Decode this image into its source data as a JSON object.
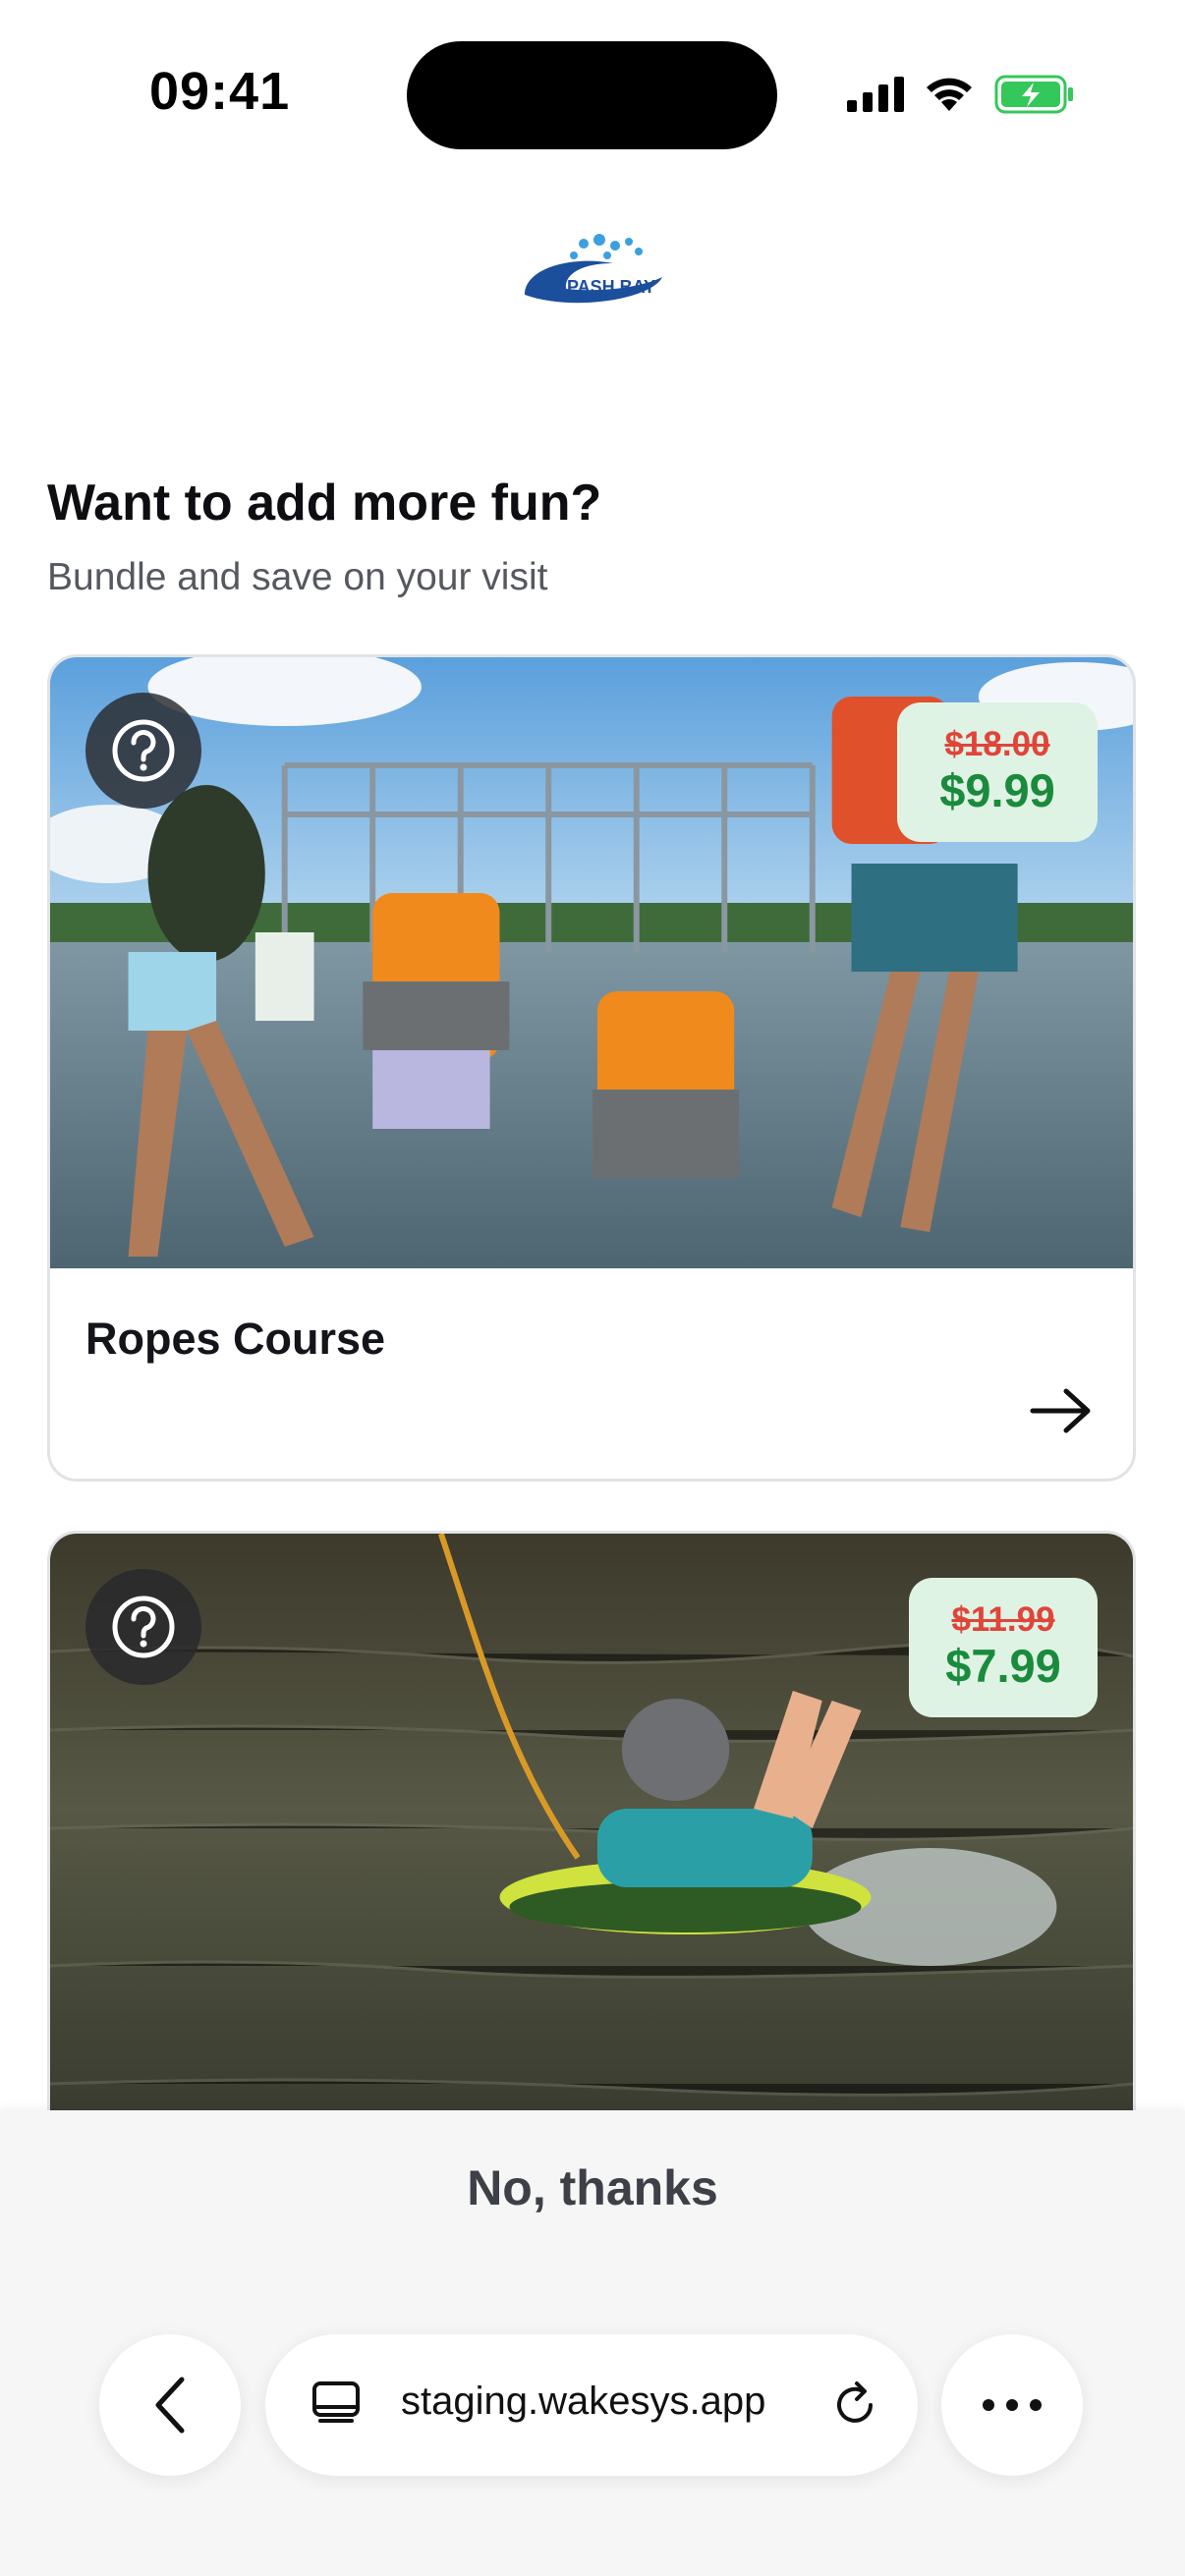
{
  "status_bar": {
    "time": "09:41",
    "icons": [
      "signal-icon",
      "wifi-icon",
      "battery-charging-icon"
    ],
    "battery_color": "#34c759"
  },
  "brand": {
    "logo_text": "SPASH BAY",
    "logo_color": "#1b5fb0"
  },
  "page": {
    "title": "Want to add more fun?",
    "subtitle": "Bundle and save on your visit"
  },
  "offers": [
    {
      "title": "Ropes Course",
      "old_price": "$18.00",
      "new_price": "$9.99",
      "image": "Family jumping into lake holding hands in life vests, aqua ropes course structure behind",
      "help_icon": "question-circle-icon",
      "arrow_icon": "arrow-right-icon"
    },
    {
      "title": "",
      "old_price": "$11.99",
      "new_price": "$7.99",
      "image": "Kid on bodyboard pulled by cable across dark water, wearing helmet",
      "help_icon": "question-circle-icon"
    }
  ],
  "actions": {
    "decline": "No, thanks"
  },
  "browser": {
    "url": "staging.wakesys.app",
    "back_icon": "chevron-left-icon",
    "tabs_icon": "tabs-icon",
    "reload_icon": "reload-icon",
    "more_icon": "more-horizontal-icon"
  },
  "colors": {
    "price_new": "#1a8b3c",
    "price_old": "#e0453a",
    "price_badge_bg": "#dff3e4"
  }
}
